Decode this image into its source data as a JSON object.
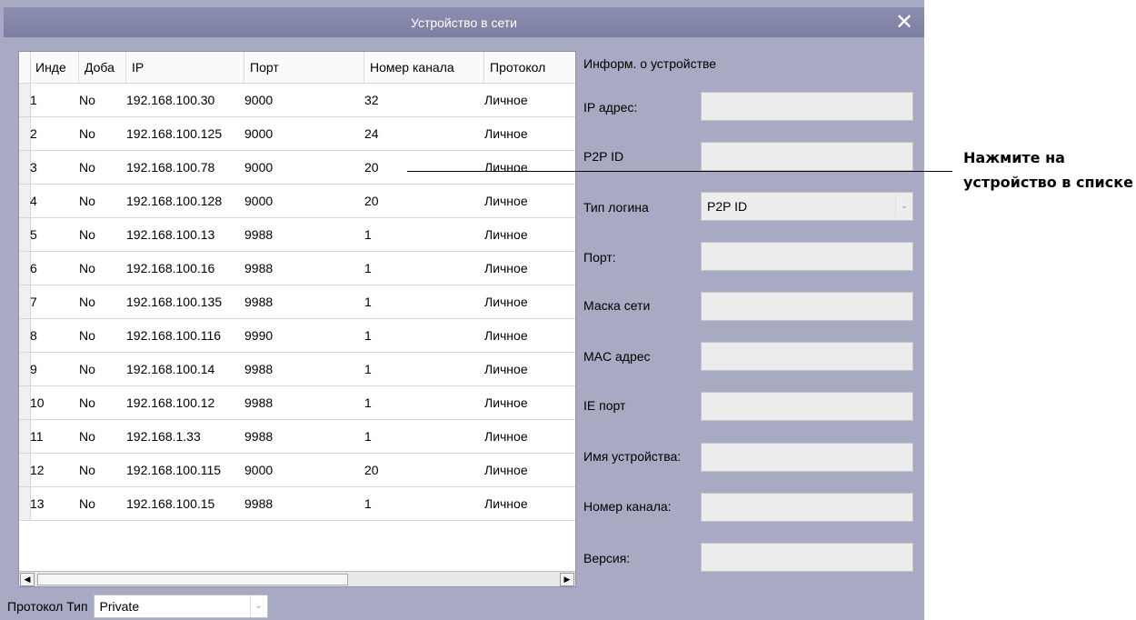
{
  "window": {
    "title": "Устройство в сети",
    "close_glyph": "✕"
  },
  "table": {
    "columns": [
      "Инде",
      "Доба",
      "IP",
      "Порт",
      "Номер канала",
      "Протокол"
    ],
    "rows": [
      [
        "1",
        "No",
        "192.168.100.30",
        "9000",
        "32",
        "Личное"
      ],
      [
        "2",
        "No",
        "192.168.100.125",
        "9000",
        "24",
        "Личное"
      ],
      [
        "3",
        "No",
        "192.168.100.78",
        "9000",
        "20",
        "Личное"
      ],
      [
        "4",
        "No",
        "192.168.100.128",
        "9000",
        "20",
        "Личное"
      ],
      [
        "5",
        "No",
        "192.168.100.13",
        "9988",
        "1",
        "Личное"
      ],
      [
        "6",
        "No",
        "192.168.100.16",
        "9988",
        "1",
        "Личное"
      ],
      [
        "7",
        "No",
        "192.168.100.135",
        "9988",
        "1",
        "Личное"
      ],
      [
        "8",
        "No",
        "192.168.100.116",
        "9990",
        "1",
        "Личное"
      ],
      [
        "9",
        "No",
        "192.168.100.14",
        "9988",
        "1",
        "Личное"
      ],
      [
        "10",
        "No",
        "192.168.100.12",
        "9988",
        "1",
        "Личное"
      ],
      [
        "11",
        "No",
        "192.168.1.33",
        "9988",
        "1",
        "Личное"
      ],
      [
        "12",
        "No",
        "192.168.100.115",
        "9000",
        "20",
        "Личное"
      ],
      [
        "13",
        "No",
        "192.168.100.15",
        "9988",
        "1",
        "Личное"
      ]
    ],
    "scroll_left_glyph": "◀",
    "scroll_right_glyph": "▶"
  },
  "protocol": {
    "label": "Протокол Тип",
    "value": "Private"
  },
  "info": {
    "title": "Информ. о устройстве",
    "ip_label": "IP адрес:",
    "ip_value": "",
    "p2p_label": "P2P ID",
    "p2p_value": "",
    "login_type_label": "Тип логина",
    "login_type_value": "P2P ID",
    "port_label": "Порт:",
    "port_value": "",
    "mask_label": "Маска сети",
    "mask_value": "",
    "mac_label": "MAC адрес",
    "mac_value": "",
    "ie_label": "IE порт",
    "ie_value": "",
    "name_label": "Имя устройства:",
    "name_value": "",
    "channel_label": "Номер канала:",
    "channel_value": "",
    "version_label": "Версия:",
    "version_value": ""
  },
  "annotation": {
    "line1": "Нажмите на",
    "line2": "устройство в списке"
  },
  "colors": {
    "dialog_bg": "#a8a9c3",
    "titlebar": "#8587aa",
    "field_bg": "#ececec"
  }
}
